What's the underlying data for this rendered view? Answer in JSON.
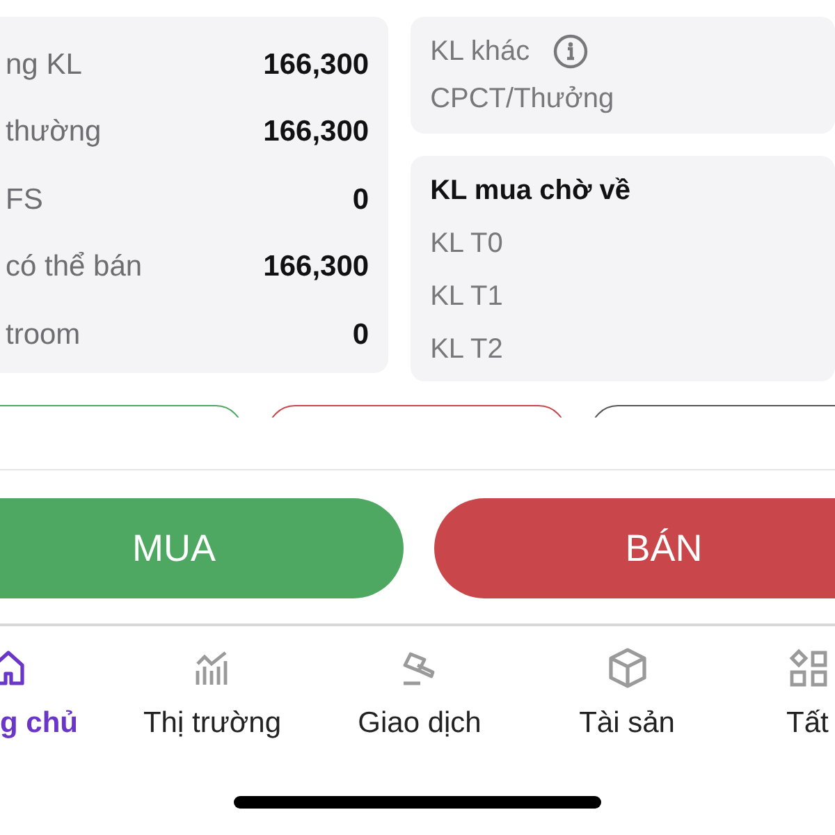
{
  "holdings": [
    {
      "label": "ng KL",
      "value": "166,300"
    },
    {
      "label": "thường",
      "value": "166,300"
    },
    {
      "label": "FS",
      "value": "0"
    },
    {
      "label": "có thể bán",
      "value": "166,300"
    },
    {
      "label": "troom",
      "value": "0"
    }
  ],
  "other": {
    "label": "KL khác",
    "sub": "CPCT/Thưởng"
  },
  "pending": {
    "title": "KL mua chờ về",
    "items": [
      "KL T0",
      "KL T1",
      "KL T2"
    ]
  },
  "outline_buttons": [
    {
      "color": "#4ea862"
    },
    {
      "color": "#c9474a"
    },
    {
      "color": "#555555"
    }
  ],
  "actions": [
    {
      "label": "MUA",
      "kind": "buy"
    },
    {
      "label": "BÁN",
      "kind": "sell"
    }
  ],
  "nav": [
    {
      "label": "g chủ",
      "selected": true
    },
    {
      "label": "Thị trường",
      "selected": false
    },
    {
      "label": "Giao dịch",
      "selected": false
    },
    {
      "label": "Tài sản",
      "selected": false
    },
    {
      "label": "Tất",
      "selected": false
    }
  ]
}
